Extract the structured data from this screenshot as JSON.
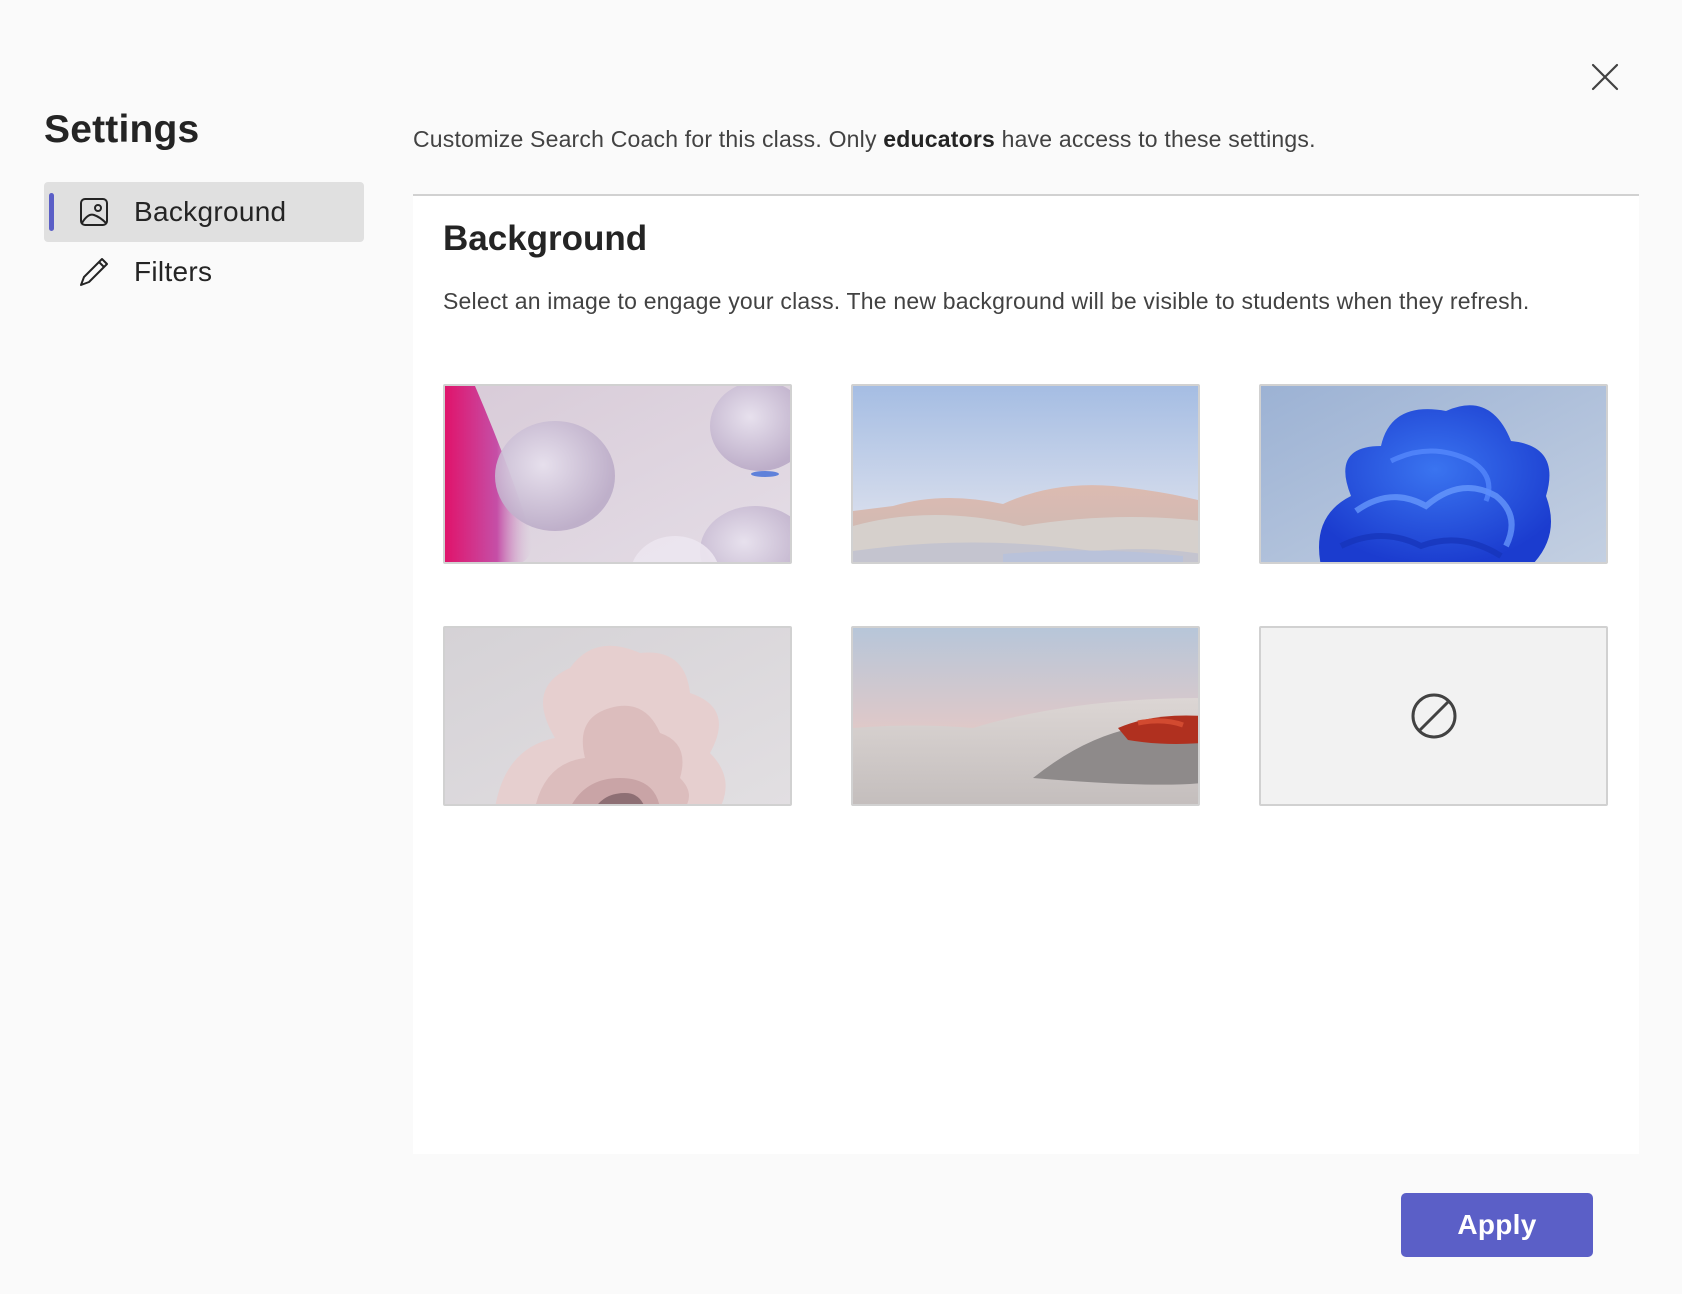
{
  "dialog": {
    "close_label": "Close"
  },
  "sidebar": {
    "title": "Settings",
    "items": [
      {
        "label": "Background",
        "icon": "image-icon",
        "active": true
      },
      {
        "label": "Filters",
        "icon": "pen-icon",
        "active": false
      }
    ]
  },
  "intro": {
    "text_before": "Customize Search Coach for this class. Only ",
    "text_bold": "educators",
    "text_after": " have access to these settings."
  },
  "panel": {
    "title": "Background",
    "description": "Select an image to engage your class. The new background will be visible to students when they refresh.",
    "backgrounds": [
      {
        "name": "pink-bubbles"
      },
      {
        "name": "desert-dunes-sky"
      },
      {
        "name": "blue-bloom"
      },
      {
        "name": "pink-flower"
      },
      {
        "name": "dune-red-rocks"
      },
      {
        "name": "no-background",
        "icon": "prohibited-icon"
      }
    ]
  },
  "footer": {
    "apply_label": "Apply"
  },
  "colors": {
    "accent": "#5b5fc7",
    "active_nav_bg": "#e0e0e0",
    "page_bg": "#fafafa",
    "panel_bg": "#ffffff"
  }
}
